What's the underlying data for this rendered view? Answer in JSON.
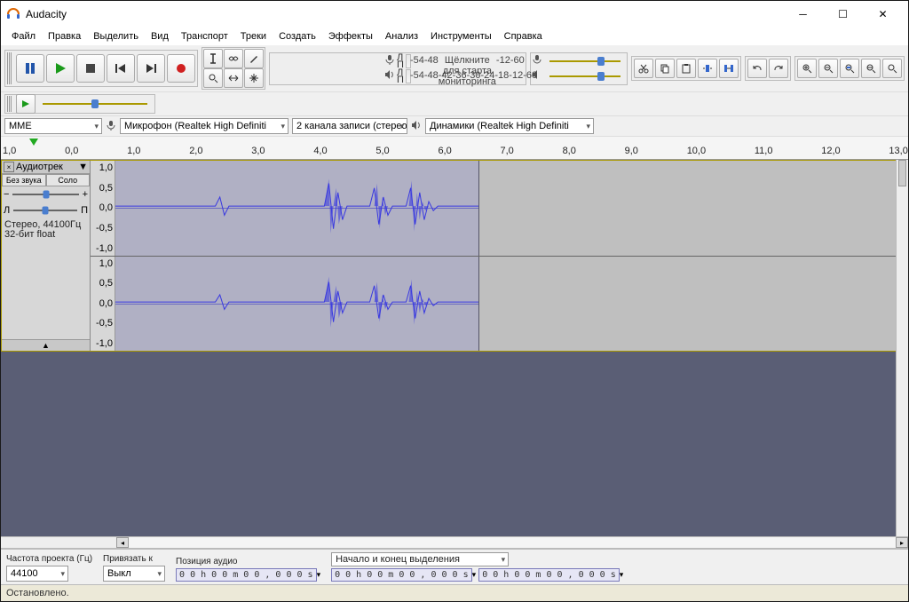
{
  "title": "Audacity",
  "menu": [
    "Файл",
    "Правка",
    "Выделить",
    "Вид",
    "Транспорт",
    "Треки",
    "Создать",
    "Эффекты",
    "Анализ",
    "Инструменты",
    "Справка"
  ],
  "meter_ticks": [
    "-54",
    "-48",
    "-42",
    "-36",
    "-30",
    "-24",
    "-18",
    "-12",
    "-6",
    "0"
  ],
  "meter_hint": "Щёлкните для старта мониторинга",
  "meter_channel_labels": [
    "Л",
    "П"
  ],
  "device": {
    "host": "MME",
    "input": "Микрофон (Realtek High Definiti",
    "channels": "2 канала записи (стерео",
    "output": "Динамики (Realtek High Definiti"
  },
  "ruler": [
    "1,0",
    "0,0",
    "1,0",
    "2,0",
    "3,0",
    "4,0",
    "5,0",
    "6,0",
    "7,0",
    "8,0",
    "9,0",
    "10,0",
    "11,0",
    "12,0",
    "13,0"
  ],
  "track": {
    "name": "Аудиотрек",
    "mute": "Без звука",
    "solo": "Соло",
    "pan_left": "Л",
    "pan_right": "П",
    "format1": "Стерео, 44100Гц",
    "format2": "32-бит float",
    "vscale": [
      "1,0",
      "0,5",
      "0,0",
      "-0,5",
      "-1,0"
    ]
  },
  "bottom": {
    "rate_label": "Частота проекта (Гц)",
    "rate": "44100",
    "snap_label": "Привязать к",
    "snap": "Выкл",
    "pos_label": "Позиция аудио",
    "pos": "0 0 h 0 0 m 0 0 , 0 0 0 s",
    "sel_label": "Начало и конец выделения",
    "sel_start": "0 0 h 0 0 m 0 0 , 0 0 0 s",
    "sel_end": "0 0 h 0 0 m 0 0 , 0 0 0 s"
  },
  "status": "Остановлено."
}
